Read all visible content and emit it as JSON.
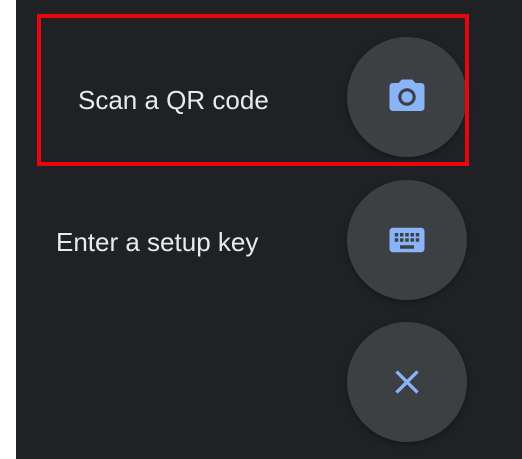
{
  "menu": {
    "scan_qr_label": "Scan a QR code",
    "setup_key_label": "Enter a setup key"
  },
  "icons": {
    "scan": "camera-icon",
    "setup": "keyboard-icon",
    "close": "close-icon"
  },
  "colors": {
    "background": "#202124",
    "fab": "#3c4043",
    "icon_accent": "#8ab4f8",
    "label_text": "#e8eaed",
    "highlight": "#e8060b"
  }
}
